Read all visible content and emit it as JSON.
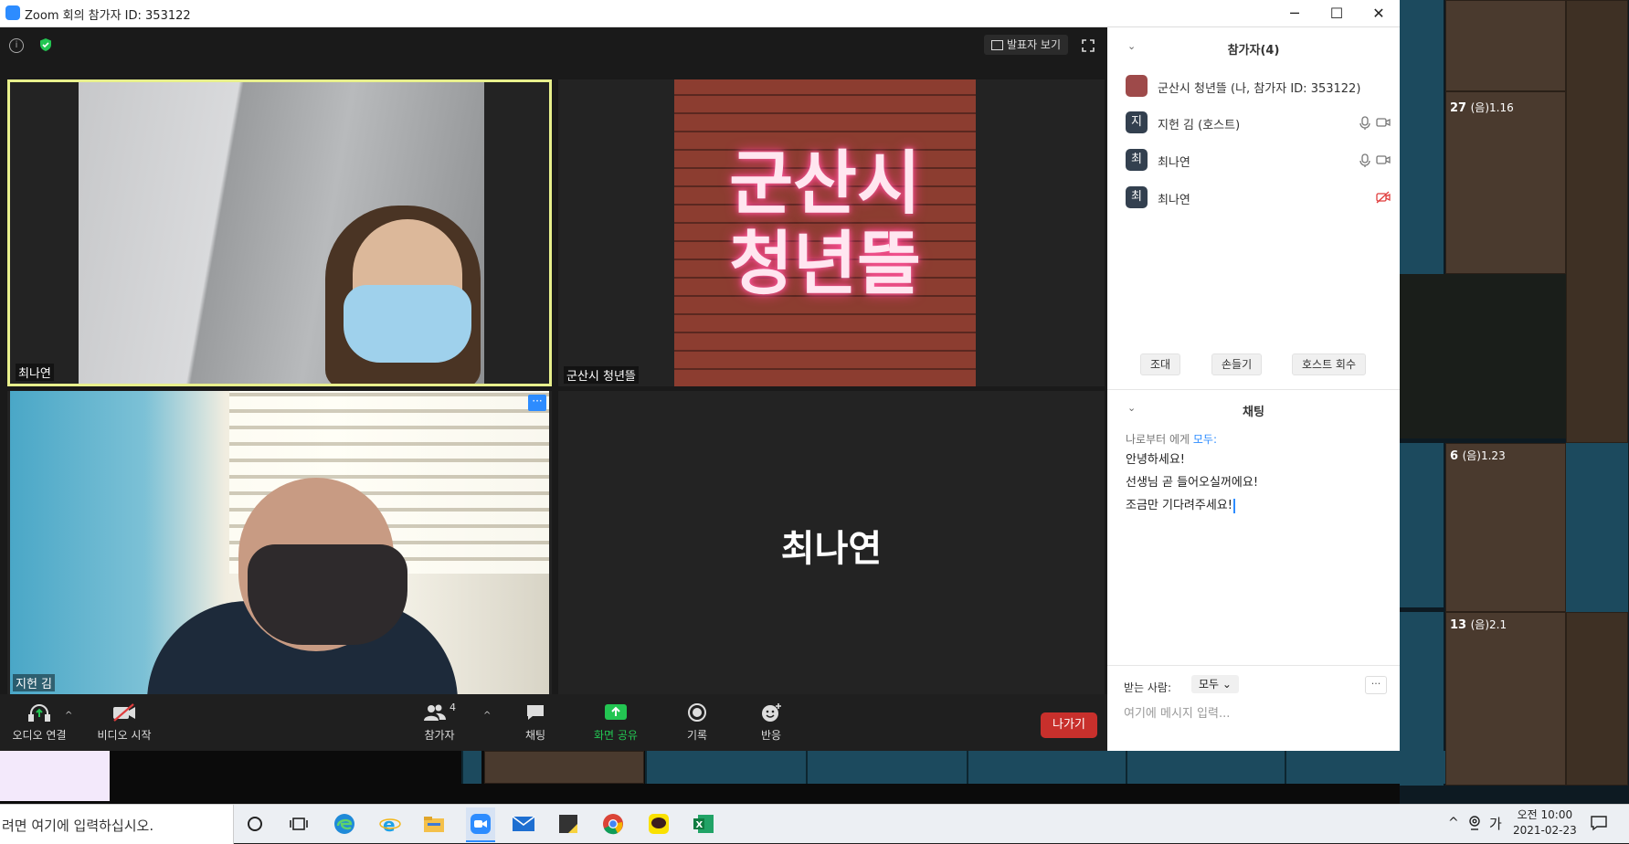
{
  "window": {
    "title": "Zoom 회의 참가자 ID: 353122",
    "minimize": "─",
    "maximize": "☐",
    "close": "✕"
  },
  "top_bar": {
    "info": "i",
    "speaker_view": "발표자 보기"
  },
  "tiles": [
    {
      "name": "최나연",
      "type": "video"
    },
    {
      "name": "군산시 청년뜰",
      "type": "image",
      "neon_line1": "군산시",
      "neon_line2": "청년뜰"
    },
    {
      "name": "지헌 김",
      "type": "video"
    },
    {
      "name": "최나연",
      "type": "avatar",
      "display": "최나연"
    }
  ],
  "toolbar": {
    "audio": "오디오 연결",
    "video": "비디오 시작",
    "participants": "참가자",
    "participants_count": "4",
    "chat": "채팅",
    "share": "화면 공유",
    "record": "기록",
    "reactions": "반응",
    "leave": "나가기",
    "more": "···"
  },
  "participants_panel": {
    "title": "참가자(4)",
    "items": [
      {
        "avatar": "",
        "name": "군산시 청년뜰 (나, 참가자 ID: 353122)",
        "mic": false,
        "cam": false
      },
      {
        "avatar": "지",
        "name": "지헌 김 (호스트)",
        "mic": true,
        "cam": true
      },
      {
        "avatar": "최",
        "name": "최나연",
        "mic": true,
        "cam": true
      },
      {
        "avatar": "최",
        "name": "최나연",
        "mic": false,
        "cam": "off"
      }
    ],
    "buttons": {
      "invite": "조대",
      "raise_hand": "손들기",
      "reclaim_host": "호스트 회수"
    }
  },
  "chat_panel": {
    "title": "채팅",
    "from_prefix": "나로부터 에게",
    "from_target": "모두:",
    "messages": [
      "안녕하세요!",
      "선생님 곧 들어오실꺼에요!",
      "조금만 기다려주세요!"
    ],
    "to_label": "받는 사람:",
    "to_value": "모두 ⌄",
    "more": "···",
    "placeholder": "여기에 메시지 입력..."
  },
  "desktop_calendar": [
    {
      "day": "27",
      "lunar": "(음)1.16"
    },
    {
      "day": "6",
      "lunar": "(음)1.23"
    },
    {
      "day": "13",
      "lunar": "(음)2.1"
    }
  ],
  "taskbar": {
    "search_placeholder": "려면 여기에 입력하십시오.",
    "ime": "가",
    "time": "오전 10:00",
    "date": "2021-02-23"
  }
}
